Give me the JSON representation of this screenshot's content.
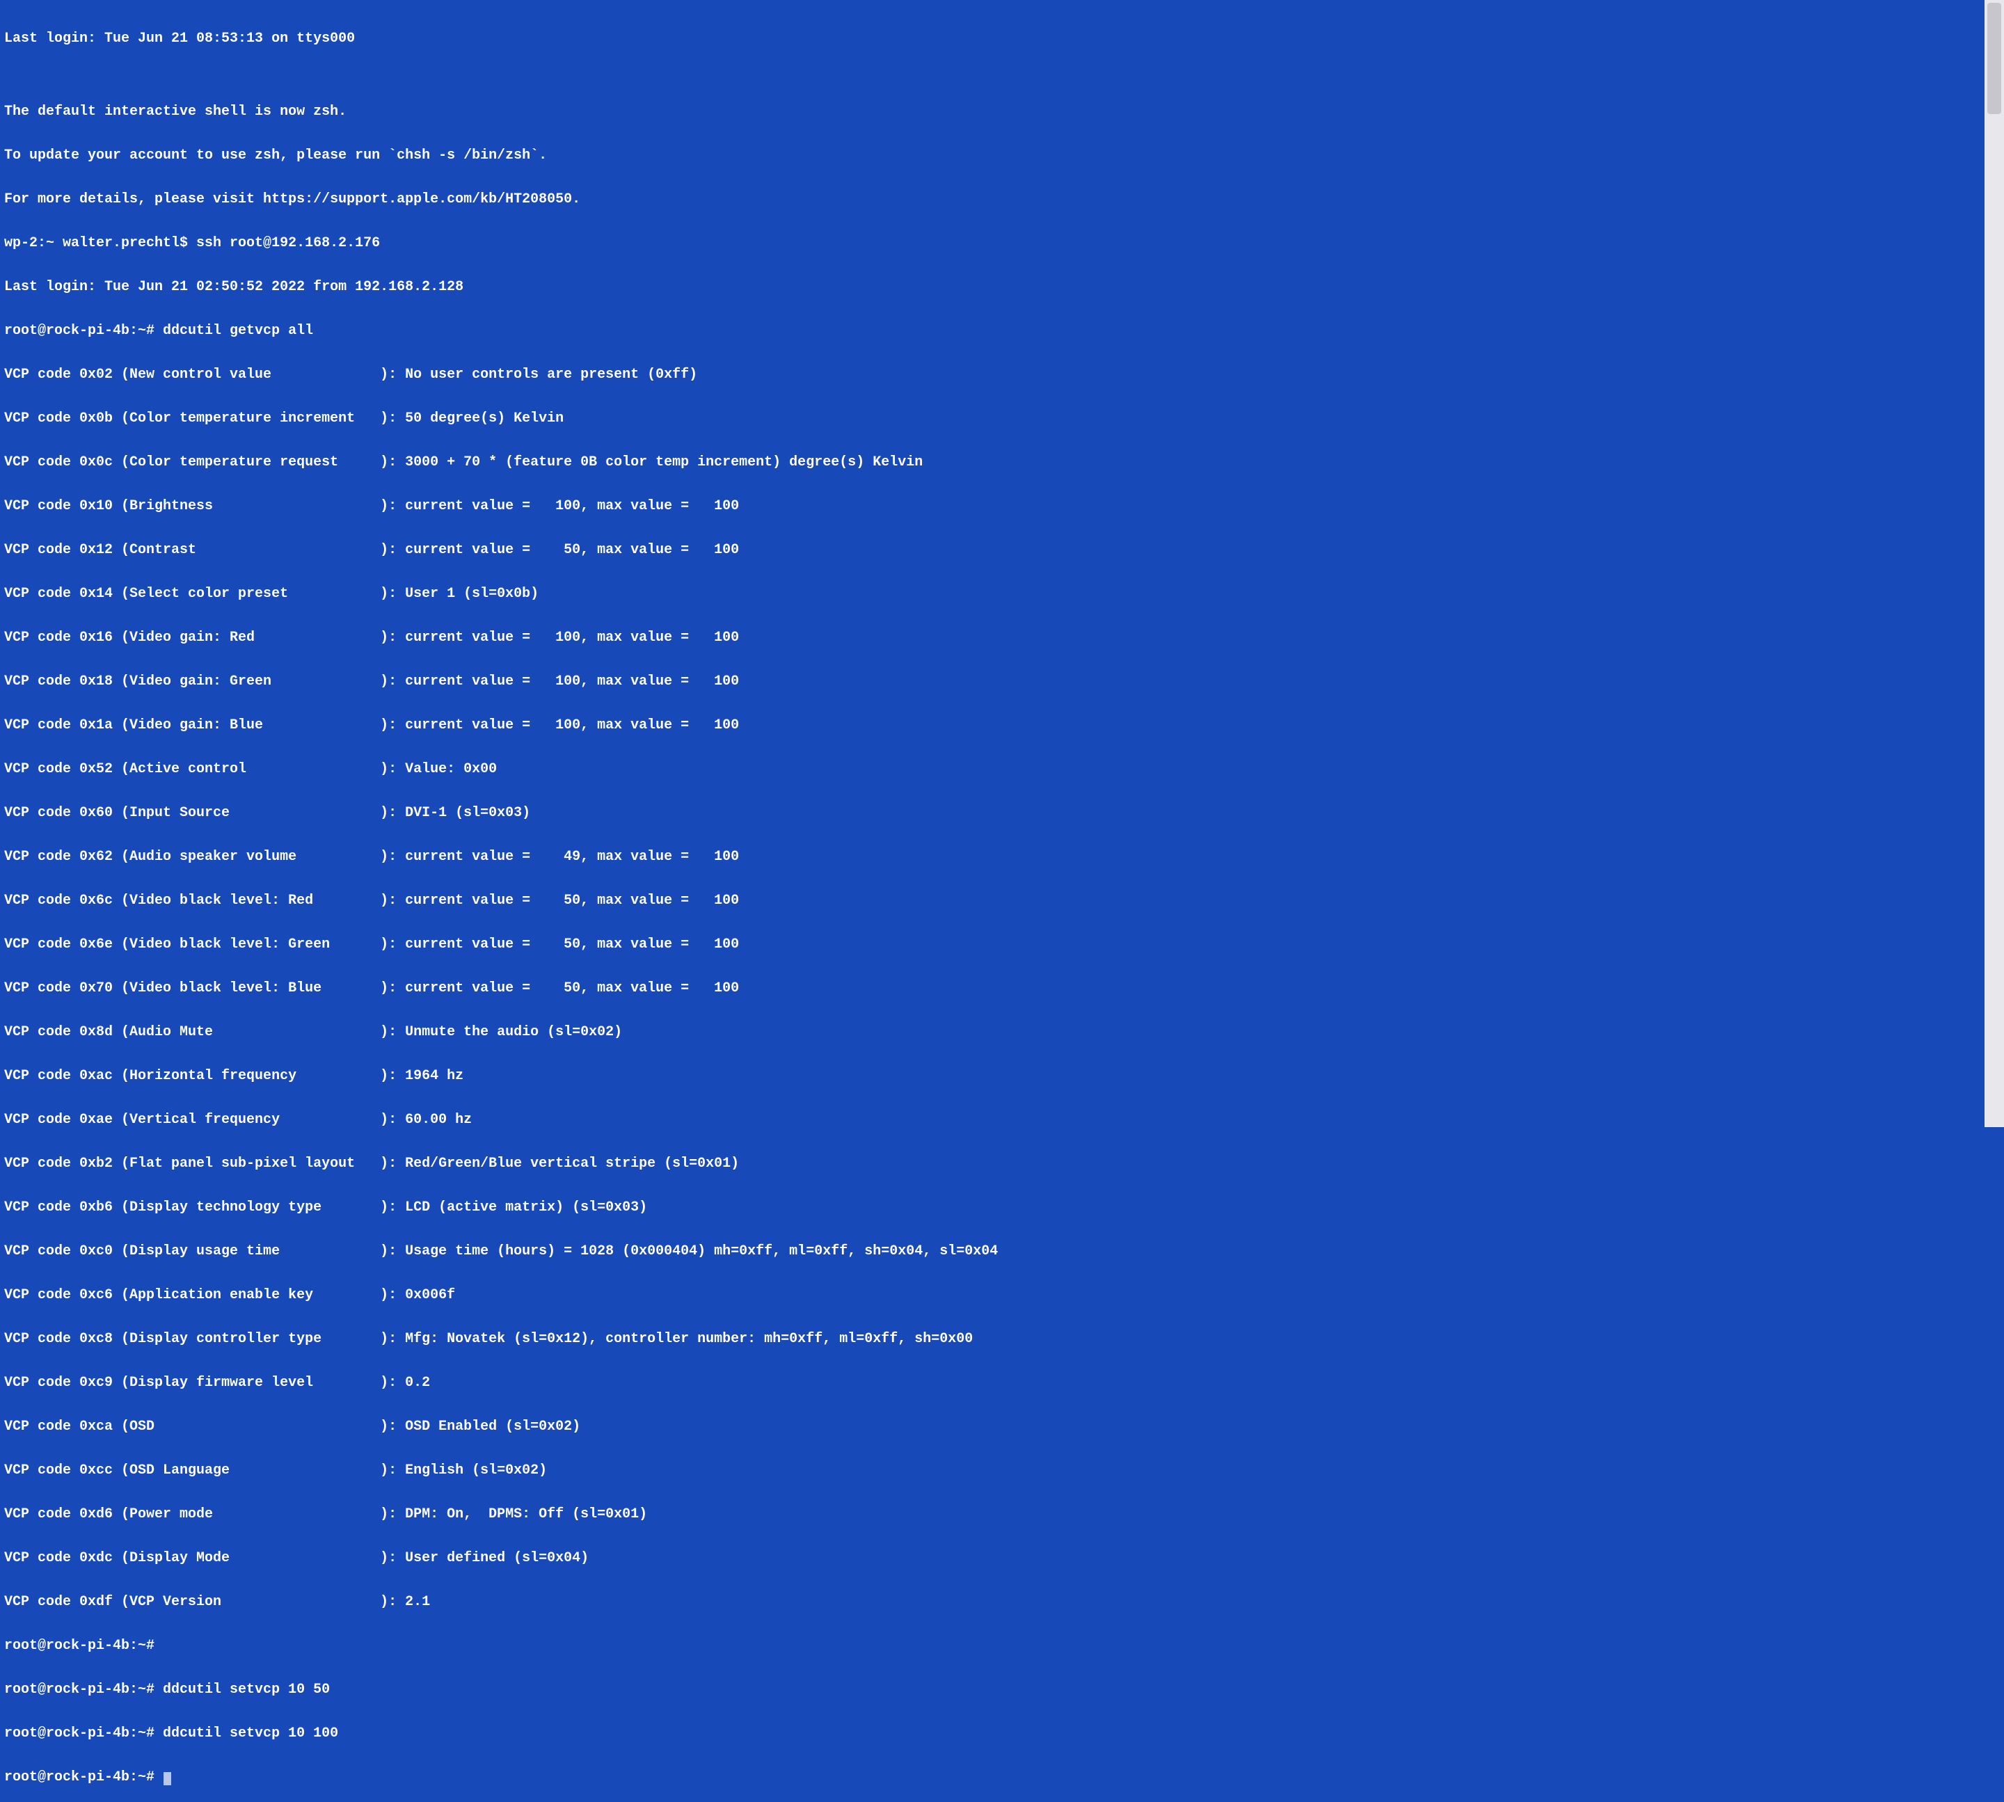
{
  "colors": {
    "background": "#1849b8",
    "foreground": "#ffffff",
    "cursor": "#b8c8e8",
    "scroll_gutter": "#e8e8ec",
    "scroll_thumb": "#c6c6cc"
  },
  "session": {
    "last_login_local": "Last login: Tue Jun 21 08:53:13 on ttys000",
    "blank1": "",
    "zsh_notice_1": "The default interactive shell is now zsh.",
    "zsh_notice_2": "To update your account to use zsh, please run `chsh -s /bin/zsh`.",
    "zsh_notice_3": "For more details, please visit https://support.apple.com/kb/HT208050.",
    "local_prompt_ssh": "wp-2:~ walter.prechtl$ ssh root@192.168.2.176",
    "remote_last_login": "Last login: Tue Jun 21 02:50:52 2022 from 192.168.2.128",
    "cmd_getvcp": "root@rock-pi-4b:~# ddcutil getvcp all"
  },
  "vcp_lines": [
    "VCP code 0x02 (New control value             ): No user controls are present (0xff)",
    "VCP code 0x0b (Color temperature increment   ): 50 degree(s) Kelvin",
    "VCP code 0x0c (Color temperature request     ): 3000 + 70 * (feature 0B color temp increment) degree(s) Kelvin",
    "VCP code 0x10 (Brightness                    ): current value =   100, max value =   100",
    "VCP code 0x12 (Contrast                      ): current value =    50, max value =   100",
    "VCP code 0x14 (Select color preset           ): User 1 (sl=0x0b)",
    "VCP code 0x16 (Video gain: Red               ): current value =   100, max value =   100",
    "VCP code 0x18 (Video gain: Green             ): current value =   100, max value =   100",
    "VCP code 0x1a (Video gain: Blue              ): current value =   100, max value =   100",
    "VCP code 0x52 (Active control                ): Value: 0x00",
    "VCP code 0x60 (Input Source                  ): DVI-1 (sl=0x03)",
    "VCP code 0x62 (Audio speaker volume          ): current value =    49, max value =   100",
    "VCP code 0x6c (Video black level: Red        ): current value =    50, max value =   100",
    "VCP code 0x6e (Video black level: Green      ): current value =    50, max value =   100",
    "VCP code 0x70 (Video black level: Blue       ): current value =    50, max value =   100",
    "VCP code 0x8d (Audio Mute                    ): Unmute the audio (sl=0x02)",
    "VCP code 0xac (Horizontal frequency          ): 1964 hz",
    "VCP code 0xae (Vertical frequency            ): 60.00 hz",
    "VCP code 0xb2 (Flat panel sub-pixel layout   ): Red/Green/Blue vertical stripe (sl=0x01)",
    "VCP code 0xb6 (Display technology type       ): LCD (active matrix) (sl=0x03)",
    "VCP code 0xc0 (Display usage time            ): Usage time (hours) = 1028 (0x000404) mh=0xff, ml=0xff, sh=0x04, sl=0x04",
    "VCP code 0xc6 (Application enable key        ): 0x006f",
    "VCP code 0xc8 (Display controller type       ): Mfg: Novatek (sl=0x12), controller number: mh=0xff, ml=0xff, sh=0x00",
    "VCP code 0xc9 (Display firmware level        ): 0.2",
    "VCP code 0xca (OSD                           ): OSD Enabled (sl=0x02)",
    "VCP code 0xcc (OSD Language                  ): English (sl=0x02)",
    "VCP code 0xd6 (Power mode                    ): DPM: On,  DPMS: Off (sl=0x01)",
    "VCP code 0xdc (Display Mode                  ): User defined (sl=0x04)",
    "VCP code 0xdf (VCP Version                   ): 2.1"
  ],
  "post": {
    "prompt_empty": "root@rock-pi-4b:~#",
    "cmd_setvcp_50": "root@rock-pi-4b:~# ddcutil setvcp 10 50",
    "cmd_setvcp_100": "root@rock-pi-4b:~# ddcutil setvcp 10 100",
    "prompt_final": "root@rock-pi-4b:~# "
  }
}
